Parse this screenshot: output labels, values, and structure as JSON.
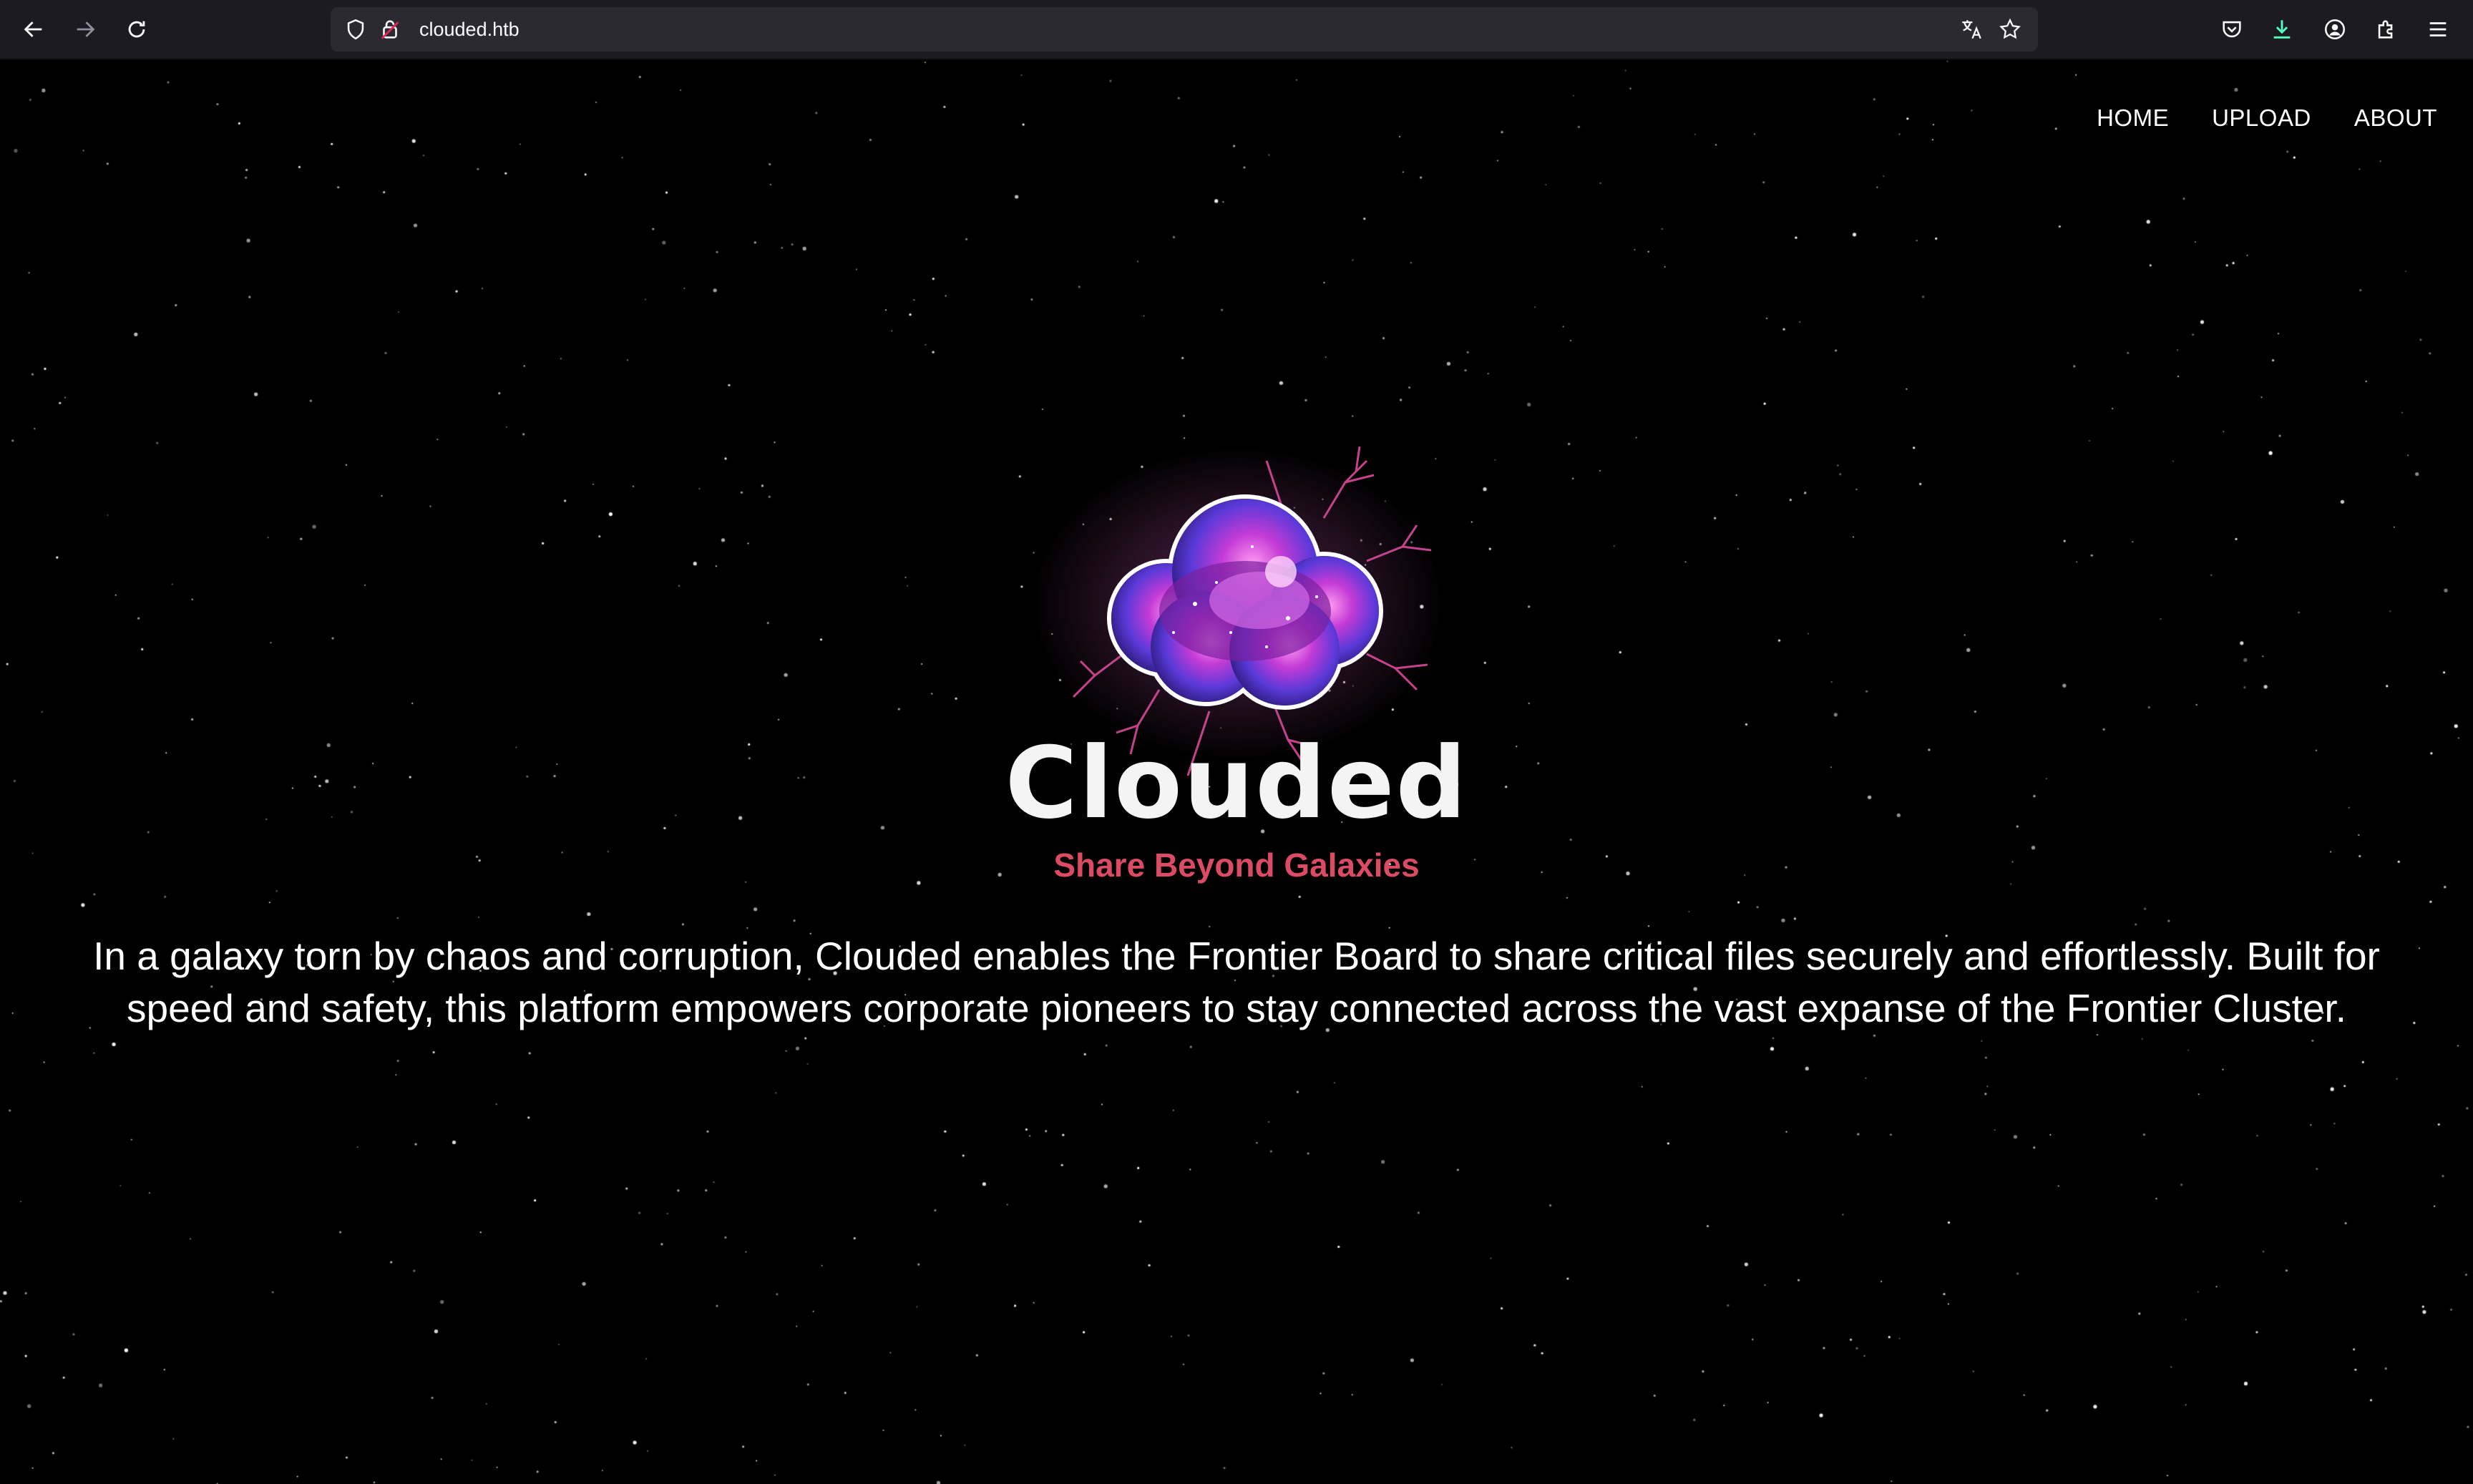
{
  "browser": {
    "url": "clouded.htb",
    "icons": [
      "back-icon",
      "forward-icon",
      "reload-icon",
      "shield-icon",
      "lock-icon",
      "translate-icon",
      "bookmark-star-icon",
      "pocket-icon",
      "downloads-icon",
      "account-icon",
      "extensions-icon",
      "menu-icon"
    ]
  },
  "nav": {
    "items": [
      "HOME",
      "UPLOAD",
      "ABOUT"
    ]
  },
  "hero": {
    "brand": "Clouded",
    "tagline": "Share Beyond Galaxies",
    "description": "In a galaxy torn by chaos and corruption, Clouded enables the Frontier Board to share critical files securely and effortlessly. Built for speed and safety, this platform empowers corporate pioneers to stay connected across the vast expanse of the Frontier Cluster."
  },
  "colors": {
    "background": "#000000",
    "accent": "#dc4b64",
    "text": "#ffffff",
    "logo_primary": "#c43bd6",
    "logo_secondary": "#5a3ad8"
  }
}
